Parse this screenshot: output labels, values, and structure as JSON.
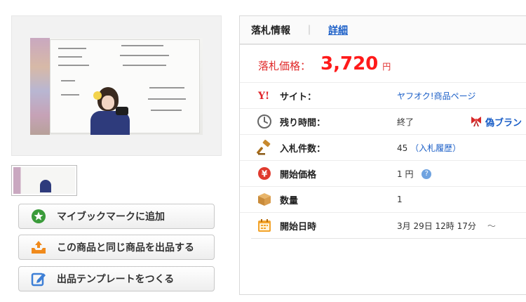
{
  "tabs": {
    "active": "落札情報",
    "separator": "｜",
    "detail": "詳細"
  },
  "price": {
    "label": "落札価格：",
    "value": "3,720",
    "unit": "円"
  },
  "rows": [
    {
      "label": "サイト：",
      "value": "ヤフオク!商品ページ",
      "icon": "yahoo-y-icon"
    },
    {
      "label": "残り時間：",
      "value": "終了",
      "icon": "clock-icon",
      "extra": "偽ブラン"
    },
    {
      "label": "入札件数：",
      "value": "45",
      "link": "（入札履歴）",
      "icon": "gavel-icon"
    },
    {
      "label": "開始価格",
      "value": "1 円",
      "icon": "yen-coin-icon",
      "help": "?"
    },
    {
      "label": "数量",
      "value": "1",
      "icon": "box-icon"
    },
    {
      "label": "開始日時",
      "value": "3月 29日 12時 17分",
      "suffix": "～",
      "icon": "calendar-icon"
    }
  ],
  "buttons": {
    "bookmark": "マイブックマークに追加",
    "sell_same": "この商品と同じ商品を出品する",
    "template": "出品テンプレートをつくる"
  },
  "colors": {
    "price_red": "#ff1a1a",
    "link_blue": "#1a5ec7",
    "bookmark_green": "#3a9b3a",
    "sell_orange": "#f08a1c",
    "template_blue": "#3d7fd6"
  }
}
